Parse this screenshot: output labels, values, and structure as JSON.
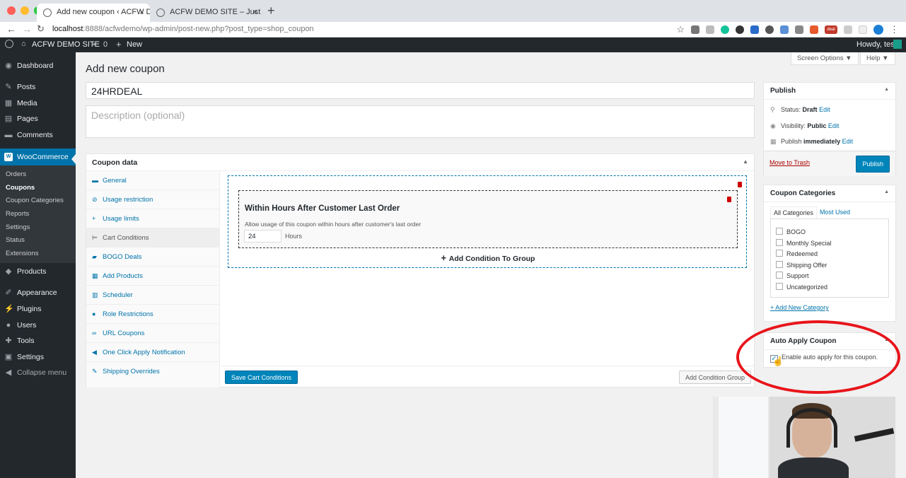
{
  "browser": {
    "tabs": [
      {
        "label": "Add new coupon ‹ ACFW DEM…"
      },
      {
        "label": "ACFW DEMO SITE – Just anoth…"
      }
    ],
    "new_tab": "+",
    "url_host": "localhost",
    "url_rest": ":8888/acfwdemo/wp-admin/post-new.php?post_type=shop_coupon",
    "ext_labels": {
      "deal": "deal"
    }
  },
  "adminbar": {
    "site_name": "ACFW DEMO SITE",
    "comments_count": "0",
    "new_label": "New",
    "howdy": "Howdy, test"
  },
  "sidebar": {
    "items": [
      {
        "label": "Dashboard",
        "icon": "dashboard-icon"
      },
      {
        "label": "Posts",
        "icon": "pin-icon"
      },
      {
        "label": "Media",
        "icon": "media-icon"
      },
      {
        "label": "Pages",
        "icon": "pages-icon"
      },
      {
        "label": "Comments",
        "icon": "comments-icon"
      },
      {
        "label": "WooCommerce",
        "icon": "woo-icon"
      },
      {
        "label": "Products",
        "icon": "products-icon"
      },
      {
        "label": "Appearance",
        "icon": "brush-icon"
      },
      {
        "label": "Plugins",
        "icon": "plugins-icon"
      },
      {
        "label": "Users",
        "icon": "users-icon"
      },
      {
        "label": "Tools",
        "icon": "tools-icon"
      },
      {
        "label": "Settings",
        "icon": "settings-icon"
      },
      {
        "label": "Collapse menu",
        "icon": "collapse-icon"
      }
    ],
    "submenu": [
      "Orders",
      "Coupons",
      "Coupon Categories",
      "Reports",
      "Settings",
      "Status",
      "Extensions"
    ]
  },
  "header": {
    "screen_options": "Screen Options ▼",
    "help": "Help ▼",
    "page_title": "Add new coupon"
  },
  "form": {
    "title_value": "24HRDEAL",
    "description_placeholder": "Description (optional)"
  },
  "coupon_data": {
    "heading": "Coupon data",
    "tabs": [
      "General",
      "Usage restriction",
      "Usage limits",
      "Cart Conditions",
      "BOGO Deals",
      "Add Products",
      "Scheduler",
      "Role Restrictions",
      "URL Coupons",
      "One Click Apply Notification",
      "Shipping Overrides"
    ],
    "condition": {
      "title": "Within Hours After Customer Last Order",
      "description": "Allow usage of this coupon within hours after customer's last order",
      "hours_value": "24",
      "hours_label": "Hours"
    },
    "add_condition": "Add Condition To Group",
    "save_button": "Save Cart Conditions",
    "add_group_button": "Add Condition Group"
  },
  "publish": {
    "heading": "Publish",
    "status_label": "Status:",
    "status_value": "Draft",
    "visibility_label": "Visibility:",
    "visibility_value": "Public",
    "publish_label": "Publish",
    "publish_value": "immediately",
    "edit": "Edit",
    "trash": "Move to Trash",
    "button": "Publish"
  },
  "categories": {
    "heading": "Coupon Categories",
    "tab_all": "All Categories",
    "tab_most": "Most Used",
    "items": [
      "BOGO",
      "Monthly Special",
      "Redeemed",
      "Shipping Offer",
      "Support",
      "Uncategorized"
    ],
    "add_new": "+ Add New Category"
  },
  "auto_apply": {
    "heading": "Auto Apply Coupon",
    "checkbox_label": "Enable auto apply for this coupon.",
    "checked": true
  },
  "colors": {
    "admin_dark": "#23282d",
    "accent": "#0073aa",
    "highlight": "#e8141a"
  }
}
